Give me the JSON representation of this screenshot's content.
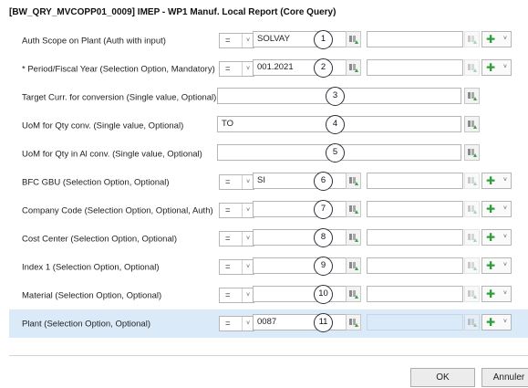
{
  "dialog": {
    "title": "[BW_QRY_MVCOPP01_0009] IMEP - WP1 Manuf. Local Report (Core Query)"
  },
  "rows": [
    {
      "label": "Auth Scope on Plant (Auth with input)",
      "operator": "=",
      "value": "SOLVAY",
      "high": "",
      "badge": "1"
    },
    {
      "label": "* Period/Fiscal Year (Selection Option, Mandatory)",
      "operator": "=",
      "value": "001.2021",
      "high": "",
      "badge": "2"
    },
    {
      "label": "Target Curr. for conversion (Single value, Optional)",
      "value": "",
      "badge": "3"
    },
    {
      "label": "UoM for Qty conv. (Single value, Optional)",
      "value": "TO",
      "badge": "4"
    },
    {
      "label": "UoM for Qty in Al conv. (Single value, Optional)",
      "value": "",
      "badge": "5"
    },
    {
      "label": "BFC GBU (Selection Option, Optional)",
      "operator": "=",
      "value": "SI",
      "high": "",
      "badge": "6"
    },
    {
      "label": "Company Code (Selection Option, Optional, Auth)",
      "operator": "=",
      "value": "",
      "high": "",
      "badge": "7"
    },
    {
      "label": "Cost Center (Selection Option, Optional)",
      "operator": "=",
      "value": "",
      "high": "",
      "badge": "8"
    },
    {
      "label": "Index 1 (Selection Option, Optional)",
      "operator": "=",
      "value": "",
      "high": "",
      "badge": "9"
    },
    {
      "label": "Material (Selection Option, Optional)",
      "operator": "=",
      "value": "",
      "high": "",
      "badge": "10"
    },
    {
      "label": "Plant (Selection Option, Optional)",
      "operator": "=",
      "value": "0087",
      "high": "",
      "badge": "11"
    }
  ],
  "icons": {
    "value_help": "value-help-icon",
    "add": "plus-icon",
    "dropdown": "chevron-down-icon"
  },
  "footer": {
    "ok_label": "OK",
    "cancel_label": "Annuler"
  },
  "colors": {
    "selected_row": "#dbeaf9",
    "add_icon": "#2e9e3a",
    "value_help_icon": "#3aa04a"
  }
}
